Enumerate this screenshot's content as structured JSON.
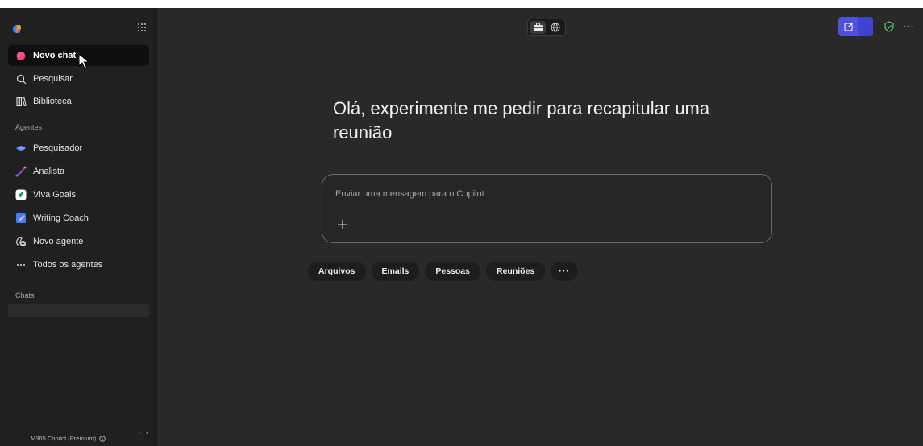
{
  "sidebar": {
    "nav": [
      {
        "label": "Novo chat",
        "icon": "chat-bubble-icon"
      },
      {
        "label": "Pesquisar",
        "icon": "search-icon"
      },
      {
        "label": "Biblioteca",
        "icon": "library-icon"
      }
    ],
    "agents_heading": "Agentes",
    "agents": [
      {
        "label": "Pesquisador",
        "icon": "researcher-icon"
      },
      {
        "label": "Analista",
        "icon": "analyst-icon"
      },
      {
        "label": "Viva Goals",
        "icon": "viva-goals-icon"
      },
      {
        "label": "Writing Coach",
        "icon": "writing-coach-icon"
      },
      {
        "label": "Novo agente",
        "icon": "new-agent-icon"
      },
      {
        "label": "Todos os agentes",
        "icon": "ellipsis-icon"
      }
    ],
    "chats_heading": "Chats",
    "footer_label": "M365 Copilot (Premium)",
    "footer_more": "···"
  },
  "main": {
    "greeting": "Olá, experimente me pedir para recapitular uma reunião",
    "composer": {
      "placeholder": "Enviar uma mensagem para o Copilot",
      "value": ""
    },
    "chips": [
      "Arquivos",
      "Emails",
      "Pessoas",
      "Reuniões"
    ],
    "chips_more": "···"
  },
  "topbar": {
    "more": "···"
  },
  "colors": {
    "accent": "#4f52d8",
    "background": "#292929",
    "sidebar": "#202020",
    "shield": "#5fc97e"
  }
}
